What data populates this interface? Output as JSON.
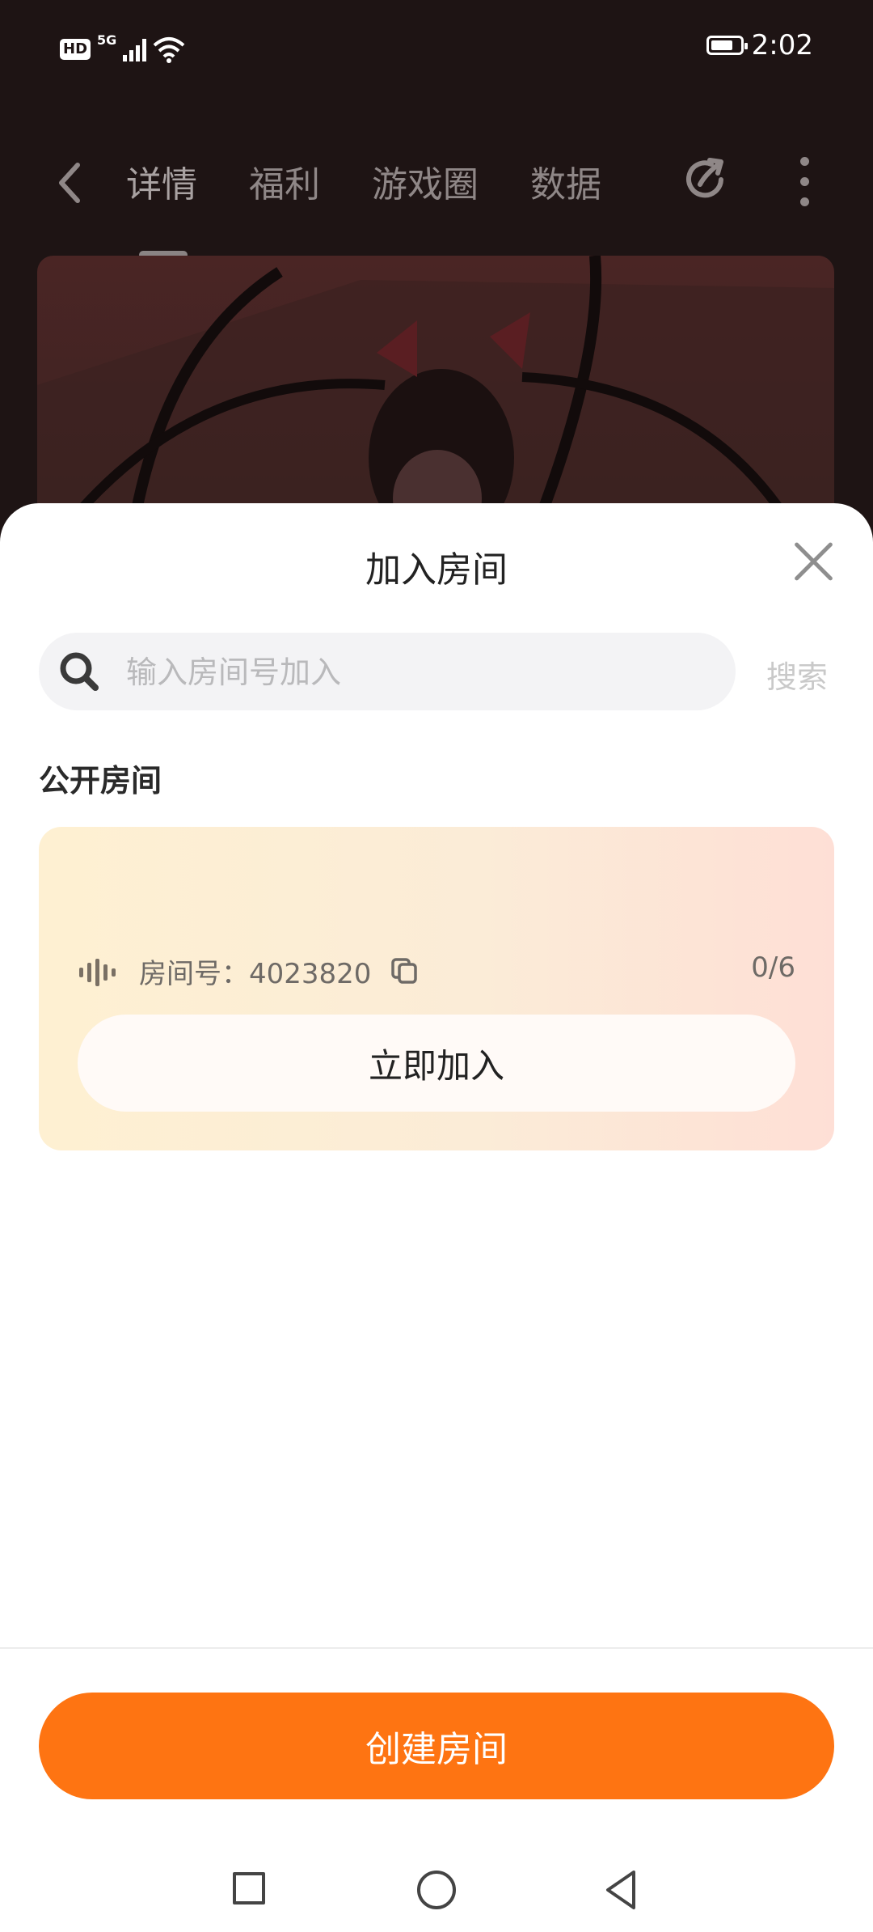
{
  "status_bar": {
    "hd_badge": "HD",
    "network": "5G",
    "time": "2:02"
  },
  "nav": {
    "tabs": [
      {
        "label": "详情",
        "active": true
      },
      {
        "label": "福利",
        "active": false
      },
      {
        "label": "游戏圈",
        "active": false
      },
      {
        "label": "数据",
        "active": false
      }
    ]
  },
  "sheet": {
    "title": "加入房间",
    "search": {
      "placeholder": "输入房间号加入",
      "button_label": "搜索"
    },
    "section_title": "公开房间",
    "room": {
      "label": "房间号：4023820",
      "count": "0/6",
      "join_label": "立即加入"
    },
    "create_label": "创建房间"
  },
  "colors": {
    "accent": "#fe7412",
    "card_gradient_start": "#fef0d2",
    "card_gradient_end": "#fedfd6"
  }
}
